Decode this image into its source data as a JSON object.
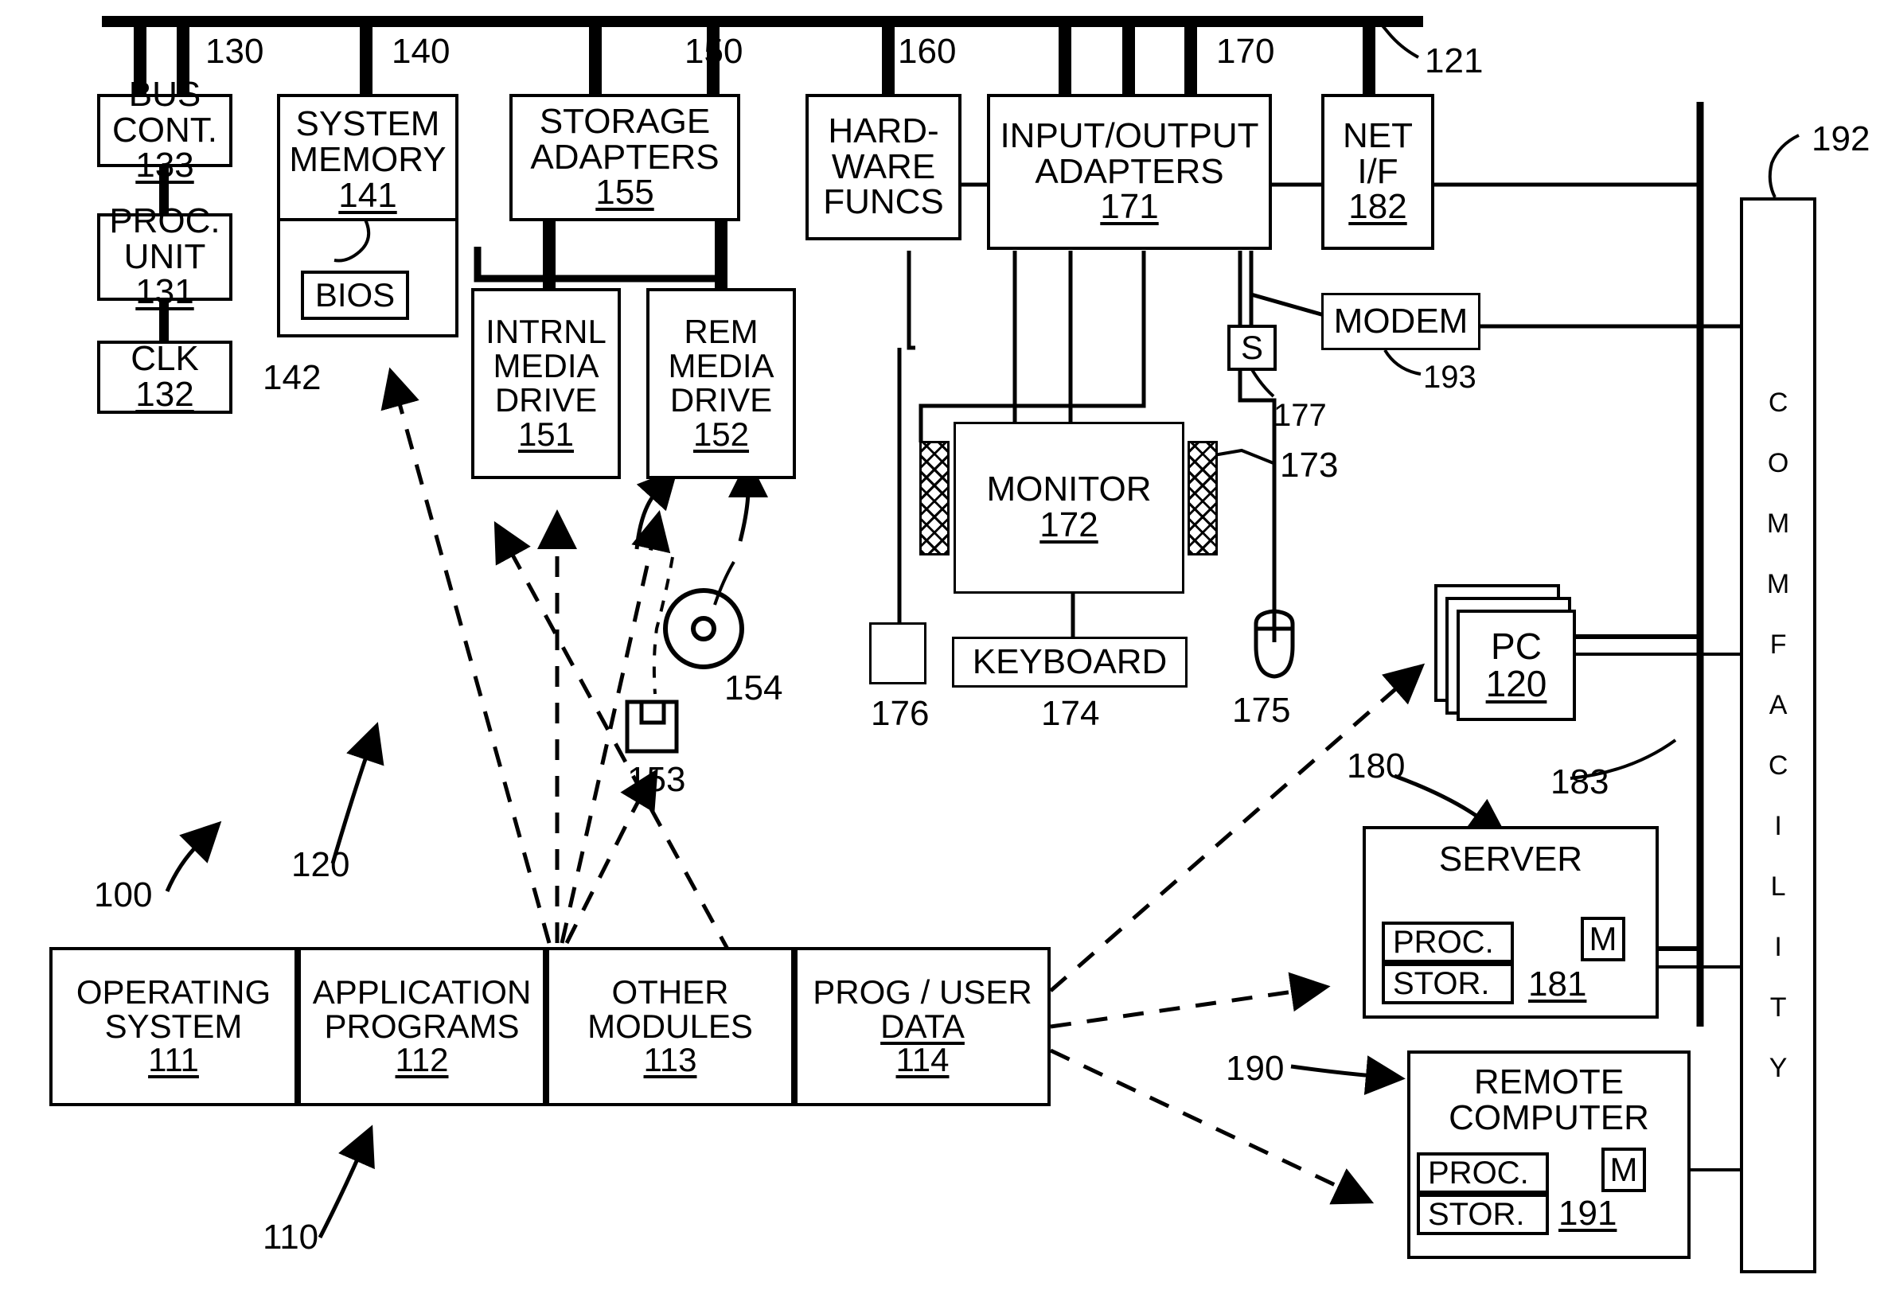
{
  "figure": {
    "title": "Computer system block diagram",
    "line_color": "#000000",
    "background": "#ffffff"
  },
  "bus": {
    "name": "system bus",
    "ref": "121",
    "segment_labels": [
      "130",
      "140",
      "150",
      "160",
      "170"
    ]
  },
  "blocks": {
    "bus_controller": {
      "lines": [
        "BUS",
        "CONT."
      ],
      "num": "133"
    },
    "proc_unit": {
      "lines": [
        "PROC.",
        "UNIT"
      ],
      "num": "131"
    },
    "clk": {
      "lines": [
        "CLK"
      ],
      "num": "132"
    },
    "system_memory": {
      "lines": [
        "SYSTEM",
        "MEMORY"
      ],
      "num": "141"
    },
    "bios": {
      "lines": [
        "BIOS"
      ],
      "num": ""
    },
    "storage_adapters": {
      "lines": [
        "STORAGE",
        "ADAPTERS"
      ],
      "num": "155"
    },
    "internal_media_drive": {
      "lines": [
        "INTRNL",
        "MEDIA",
        "DRIVE"
      ],
      "num": "151"
    },
    "removable_media_drive": {
      "lines": [
        "REM",
        "MEDIA",
        "DRIVE"
      ],
      "num": "152"
    },
    "hardware_funcs": {
      "lines": [
        "HARD-",
        "WARE",
        "FUNCS"
      ],
      "num": ""
    },
    "io_adapters": {
      "lines": [
        "INPUT/OUTPUT",
        "ADAPTERS"
      ],
      "num": "171"
    },
    "net_if": {
      "lines": [
        "NET",
        "I/F"
      ],
      "num": "182"
    },
    "modem": {
      "lines": [
        "MODEM"
      ],
      "num": ""
    },
    "s_box": {
      "lines": [
        "S"
      ],
      "num": ""
    },
    "monitor": {
      "lines": [
        "MONITOR"
      ],
      "num": "172"
    },
    "keyboard": {
      "lines": [
        "KEYBOARD"
      ],
      "num": ""
    },
    "pc": {
      "lines": [
        "PC"
      ],
      "num": "120"
    },
    "comm_facility": {
      "lines": [
        "COMM",
        "FACILITY"
      ],
      "vertical_text": "C O M M   F A C I L I T Y"
    },
    "server": {
      "title": "SERVER",
      "proc": "PROC.",
      "stor": "STOR.",
      "m": "M",
      "num": "181"
    },
    "remote_computer": {
      "title_lines": [
        "REMOTE",
        "COMPUTER"
      ],
      "proc": "PROC.",
      "stor": "STOR.",
      "m": "M",
      "num": "191"
    }
  },
  "software_row": {
    "cells": [
      {
        "lines": [
          "OPERATING",
          "SYSTEM"
        ],
        "num": "111"
      },
      {
        "lines": [
          "APPLICATION",
          "PROGRAMS"
        ],
        "num": "112"
      },
      {
        "lines": [
          "OTHER",
          "MODULES"
        ],
        "num": "113"
      },
      {
        "lines": [
          "PROG / USER",
          "DATA"
        ],
        "num": "114",
        "second_underlined": true
      }
    ],
    "ref": "110"
  },
  "reference_numerals": {
    "system_100": "100",
    "computer_120": "120",
    "bios_142": "142",
    "floppy_153": "153",
    "disc_154": "154",
    "speakers_173": "173",
    "keyboard_174": "174",
    "mouse_175": "175",
    "device_176": "176",
    "scanner_177": "177",
    "software_110": "110",
    "server_180": "180",
    "link_183": "183",
    "remote_190": "190",
    "comm_192": "192",
    "modem_193": "193",
    "bus_121": "121"
  },
  "icons": {
    "floppy": "floppy-disk-icon",
    "optical": "optical-disc-icon",
    "mouse": "mouse-icon",
    "speaker_hatch": "speaker-grille-icon"
  }
}
